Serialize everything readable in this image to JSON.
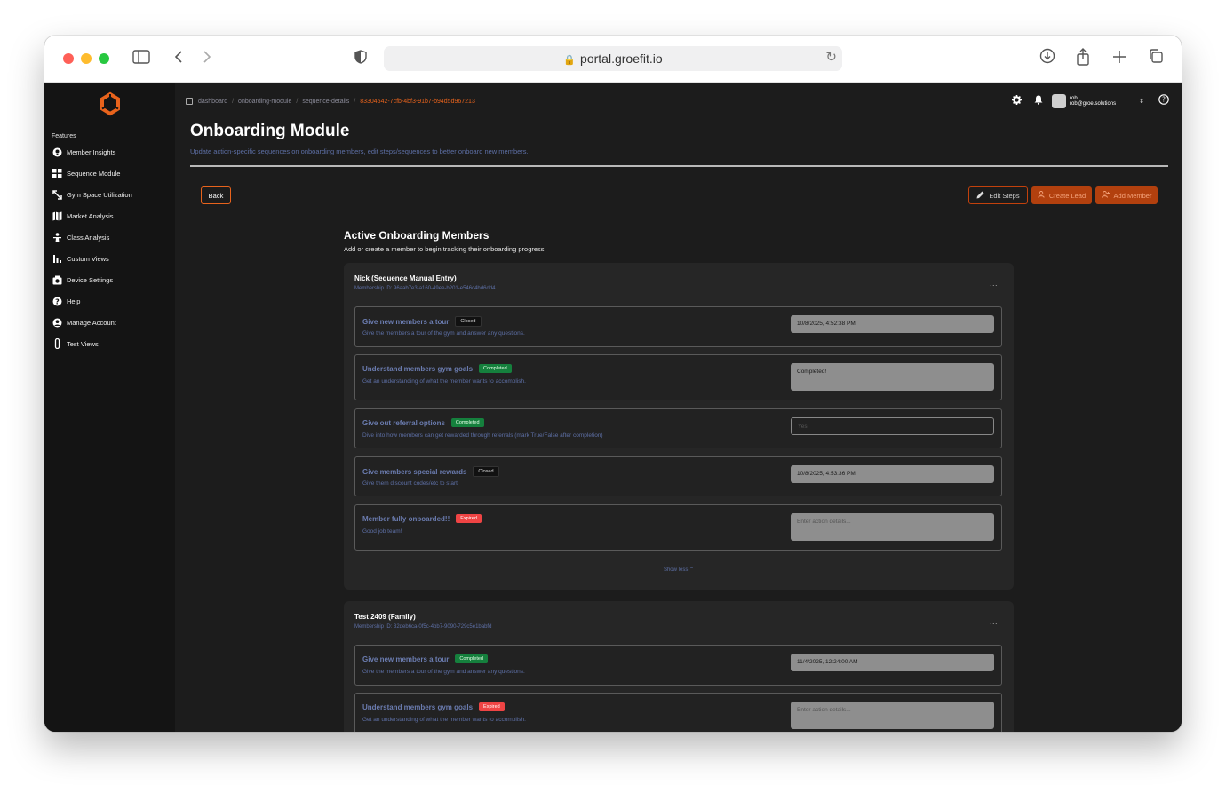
{
  "browser": {
    "url": "portal.groefit.io"
  },
  "sidebar": {
    "section_label": "Features",
    "items": [
      {
        "label": "Member Insights",
        "icon": "lightbulb-icon"
      },
      {
        "label": "Sequence Module",
        "icon": "grid-icon"
      },
      {
        "label": "Gym Space Utilization",
        "icon": "expand-arrows-icon"
      },
      {
        "label": "Market Analysis",
        "icon": "map-icon"
      },
      {
        "label": "Class Analysis",
        "icon": "person-icon"
      },
      {
        "label": "Custom Views",
        "icon": "bar-chart-icon"
      },
      {
        "label": "Device Settings",
        "icon": "camera-icon"
      },
      {
        "label": "Help",
        "icon": "question-icon"
      },
      {
        "label": "Manage Account",
        "icon": "user-circle-icon"
      },
      {
        "label": "Test Views",
        "icon": "test-tube-icon"
      }
    ]
  },
  "breadcrumb": {
    "items": [
      "dashboard",
      "onboarding-module",
      "sequence-details"
    ],
    "current": "83304542-7cfb-4bf3-91b7-b94d5d967213"
  },
  "user": {
    "name": "rob",
    "email": "rob@groe.solutions"
  },
  "header": {
    "title": "Onboarding Module",
    "subtitle": "Update action-specific sequences on onboarding members, edit steps/sequences to better onboard new members."
  },
  "toolbar": {
    "back_label": "Back",
    "edit_steps_label": "Edit Steps",
    "create_lead_label": "Create Lead",
    "add_member_label": "Add Member"
  },
  "section": {
    "title": "Active Onboarding Members",
    "subtitle": "Add or create a member to begin tracking their onboarding progress."
  },
  "members": [
    {
      "name": "Nick (Sequence Manual Entry)",
      "membership_id": "Membership ID: 96aab7e3-a160-49ee-b201-e546c4bd6dd4",
      "more": "...",
      "show_less": "Show less",
      "steps": [
        {
          "title": "Give new members a tour",
          "status": "Closed",
          "desc": "Give the members a tour of the gym and answer any questions.",
          "value": "10/8/2025, 4:52:38 PM"
        },
        {
          "title": "Understand members gym goals",
          "status": "Completed",
          "desc": "Get an understanding of what the member wants to accomplish.",
          "value": "Completed!"
        },
        {
          "title": "Give out referral options",
          "status": "Completed",
          "desc": "Dive into how members can get rewarded through referrals (mark True/False after completion)",
          "value": "Yes"
        },
        {
          "title": "Give members special rewards",
          "status": "Closed",
          "desc": "Give them discount codes/etc to start",
          "value": "10/8/2025, 4:53:36 PM"
        },
        {
          "title": "Member fully onboarded!!",
          "status": "Expired",
          "desc": "Good job team!",
          "placeholder": "Enter action details..."
        }
      ]
    },
    {
      "name": "Test 2409 (Family)",
      "membership_id": "Membership ID: 32deb6ca-0f5c-4bb7-9090-729c5e1babfd",
      "more": "...",
      "steps": [
        {
          "title": "Give new members a tour",
          "status": "Completed",
          "desc": "Give the members a tour of the gym and answer any questions.",
          "value": "11/4/2025, 12:24:00 AM"
        },
        {
          "title": "Understand members gym goals",
          "status": "Expired",
          "desc": "Get an understanding of what the member wants to accomplish.",
          "placeholder": "Enter action details..."
        }
      ]
    }
  ]
}
